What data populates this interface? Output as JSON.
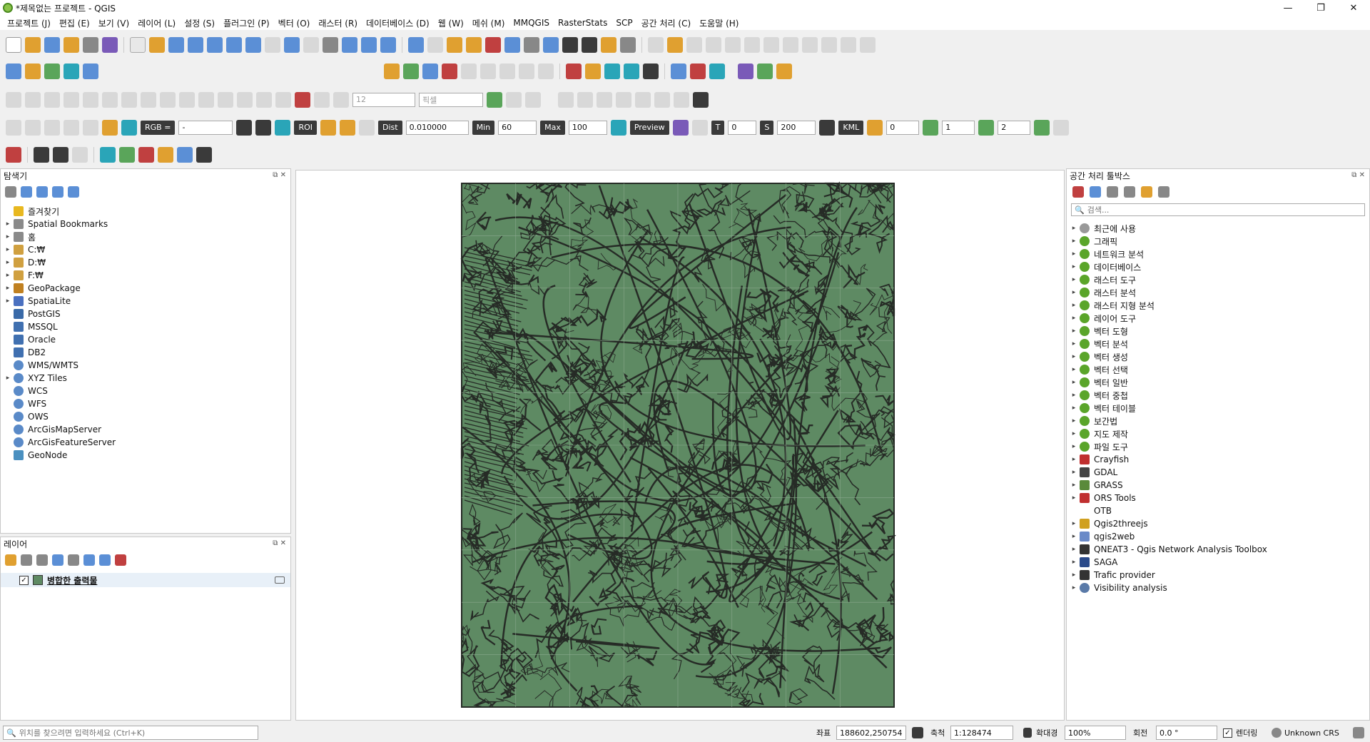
{
  "window": {
    "title": "*제목없는 프로젝트 - QGIS",
    "minimize": "—",
    "maximize": "❐",
    "close": "✕"
  },
  "menu": [
    "프로젝트 (J)",
    "편집 (E)",
    "보기 (V)",
    "레이어 (L)",
    "설정 (S)",
    "플러그인 (P)",
    "벡터 (O)",
    "래스터 (R)",
    "데이터베이스 (D)",
    "웹 (W)",
    "메쉬 (M)",
    "MMQGIS",
    "RasterStats",
    "SCP",
    "공간 처리 (C)",
    "도움말 (H)"
  ],
  "toolbar3": {
    "font_size": "12",
    "unit": "픽셀"
  },
  "toolbar4": {
    "rgb_label": "RGB =",
    "rgb_value": "-",
    "roi_label": "ROI",
    "dist_label": "Dist",
    "dist_value": "0.010000",
    "min_label": "Min",
    "min_value": "60",
    "max_label": "Max",
    "max_value": "100",
    "preview_label": "Preview",
    "t_label": "T",
    "t_value": "0",
    "s_label": "S",
    "s_value": "200",
    "kml_label": "KML",
    "band1": "0",
    "band2": "1",
    "band3": "2"
  },
  "browser": {
    "title": "탐색기",
    "items": [
      {
        "label": "즐겨찾기",
        "arrow": "",
        "icon": "star"
      },
      {
        "label": "Spatial Bookmarks",
        "arrow": "▸",
        "icon": "bookmark"
      },
      {
        "label": "홈",
        "arrow": "▸",
        "icon": "home"
      },
      {
        "label": "C:₩",
        "arrow": "▸",
        "icon": "folder"
      },
      {
        "label": "D:₩",
        "arrow": "▸",
        "icon": "folder"
      },
      {
        "label": "F:₩",
        "arrow": "▸",
        "icon": "folder"
      },
      {
        "label": "GeoPackage",
        "arrow": "▸",
        "icon": "geopackage"
      },
      {
        "label": "SpatiaLite",
        "arrow": "▸",
        "icon": "spatialite"
      },
      {
        "label": "PostGIS",
        "arrow": "",
        "icon": "postgis"
      },
      {
        "label": "MSSQL",
        "arrow": "",
        "icon": "mssql"
      },
      {
        "label": "Oracle",
        "arrow": "",
        "icon": "oracle"
      },
      {
        "label": "DB2",
        "arrow": "",
        "icon": "db2"
      },
      {
        "label": "WMS/WMTS",
        "arrow": "",
        "icon": "globe"
      },
      {
        "label": "XYZ Tiles",
        "arrow": "▸",
        "icon": "globe"
      },
      {
        "label": "WCS",
        "arrow": "",
        "icon": "globe"
      },
      {
        "label": "WFS",
        "arrow": "",
        "icon": "globe"
      },
      {
        "label": "OWS",
        "arrow": "",
        "icon": "globe"
      },
      {
        "label": "ArcGisMapServer",
        "arrow": "",
        "icon": "globe"
      },
      {
        "label": "ArcGisFeatureServer",
        "arrow": "",
        "icon": "globe"
      },
      {
        "label": "GeoNode",
        "arrow": "",
        "icon": "geonode"
      }
    ]
  },
  "layers": {
    "title": "레이어",
    "items": [
      {
        "label": "병합한 출력물",
        "checked": true,
        "color": "#5e8a63"
      }
    ]
  },
  "toolbox": {
    "title": "공간 처리 툴박스",
    "search_placeholder": "검색...",
    "items": [
      {
        "label": "최근에 사용",
        "arrow": "▸",
        "icon": "clock"
      },
      {
        "label": "그래픽",
        "arrow": "▸",
        "icon": "qgis"
      },
      {
        "label": "네트워크 분석",
        "arrow": "▸",
        "icon": "qgis"
      },
      {
        "label": "데이터베이스",
        "arrow": "▸",
        "icon": "qgis"
      },
      {
        "label": "래스터 도구",
        "arrow": "▸",
        "icon": "qgis"
      },
      {
        "label": "래스터 분석",
        "arrow": "▸",
        "icon": "qgis"
      },
      {
        "label": "래스터 지형 분석",
        "arrow": "▸",
        "icon": "qgis"
      },
      {
        "label": "레이어 도구",
        "arrow": "▸",
        "icon": "qgis"
      },
      {
        "label": "벡터 도형",
        "arrow": "▸",
        "icon": "qgis"
      },
      {
        "label": "벡터 분석",
        "arrow": "▸",
        "icon": "qgis"
      },
      {
        "label": "벡터 생성",
        "arrow": "▸",
        "icon": "qgis"
      },
      {
        "label": "벡터 선택",
        "arrow": "▸",
        "icon": "qgis"
      },
      {
        "label": "벡터 일반",
        "arrow": "▸",
        "icon": "qgis"
      },
      {
        "label": "벡터 중첩",
        "arrow": "▸",
        "icon": "qgis"
      },
      {
        "label": "벡터 테이블",
        "arrow": "▸",
        "icon": "qgis"
      },
      {
        "label": "보간법",
        "arrow": "▸",
        "icon": "qgis"
      },
      {
        "label": "지도 제작",
        "arrow": "▸",
        "icon": "qgis"
      },
      {
        "label": "파일 도구",
        "arrow": "▸",
        "icon": "qgis"
      },
      {
        "label": "Crayfish",
        "arrow": "▸",
        "icon": "crayfish"
      },
      {
        "label": "GDAL",
        "arrow": "▸",
        "icon": "gdal"
      },
      {
        "label": "GRASS",
        "arrow": "▸",
        "icon": "grass"
      },
      {
        "label": "ORS Tools",
        "arrow": "▸",
        "icon": "ors"
      },
      {
        "label": "OTB",
        "arrow": "",
        "icon": "none"
      },
      {
        "label": "Qgis2threejs",
        "arrow": "▸",
        "icon": "threejs"
      },
      {
        "label": "qgis2web",
        "arrow": "▸",
        "icon": "qgis2web"
      },
      {
        "label": "QNEAT3 - Qgis Network Analysis Toolbox",
        "arrow": "▸",
        "icon": "qneat"
      },
      {
        "label": "SAGA",
        "arrow": "▸",
        "icon": "saga"
      },
      {
        "label": "Trafic provider",
        "arrow": "▸",
        "icon": "car"
      },
      {
        "label": "Visibility analysis",
        "arrow": "▸",
        "icon": "eye"
      }
    ]
  },
  "map": {
    "fill_color": "#5e8a63",
    "line_color": "#262b26"
  },
  "status": {
    "search_placeholder": "위치를 찾으려면 입력하세요 (Ctrl+K)",
    "coord_label": "좌표",
    "coord_value": "188602,250754",
    "scale_label": "축척",
    "scale_value": "1:128474",
    "magnifier_label": "확대경",
    "magnifier_value": "100%",
    "rotation_label": "회전",
    "rotation_value": "0.0 °",
    "render_label": "렌더링",
    "crs_label": "Unknown CRS"
  }
}
